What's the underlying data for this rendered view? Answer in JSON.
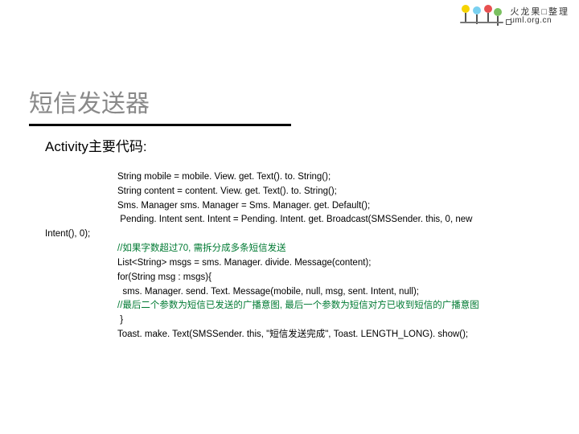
{
  "brand": {
    "name_cn": "火龙果□整理",
    "url": "uml.org.cn"
  },
  "title": "短信发送器",
  "subtitle": "Activity主要代码:",
  "code": {
    "l1": "String mobile = mobile. View. get. Text(). to. String();",
    "l2": "String content = content. View. get. Text(). to. String();",
    "l3": "Sms. Manager sms. Manager = Sms. Manager. get. Default();",
    "l4": " Pending. Intent sent. Intent = Pending. Intent. get. Broadcast(SMSSender. this, 0, new",
    "l5": "Intent(), 0);",
    "c1": "//如果字数超过70, 需拆分成多条短信发送",
    "l6": "List<String> msgs = sms. Manager. divide. Message(content);",
    "l7": "for(String msg : msgs){",
    "l8": "  sms. Manager. send. Text. Message(mobile, null, msg, sent. Intent, null);",
    "c2": "//最后二个参数为短信已发送的广播意图, 最后一个参数为短信对方已收到短信的广播意图",
    "l9": " }",
    "l10": "Toast. make. Text(SMSSender. this, \"短信发送完成\", Toast. LENGTH_LONG). show();"
  }
}
